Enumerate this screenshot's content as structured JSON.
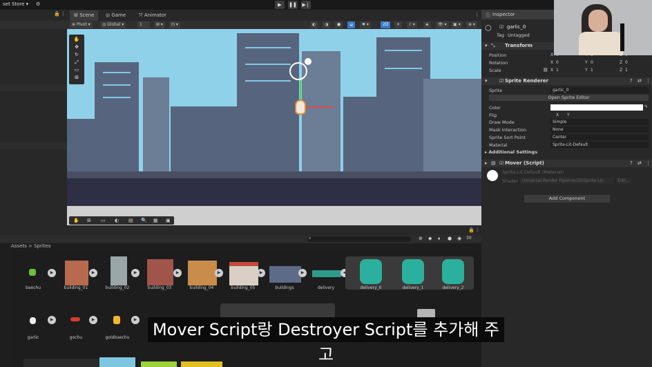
{
  "topbar": {
    "store_label": "set Store ▾",
    "play": "▶",
    "pause": "❚❚",
    "step": "▶❘"
  },
  "tabs": [
    {
      "label": "Scene"
    },
    {
      "label": "Game"
    },
    {
      "label": "Animator"
    }
  ],
  "scene_toolbar": {
    "pivot": "Pivot",
    "global": "Global",
    "grid_value": "1",
    "mode_2d": "2D"
  },
  "project": {
    "breadcrumb": "Assets > Sprites",
    "item_count": "30",
    "search_placeholder": "",
    "assets": [
      {
        "name": "baechu"
      },
      {
        "name": "building_01"
      },
      {
        "name": "building_02"
      },
      {
        "name": "building_03"
      },
      {
        "name": "building_04"
      },
      {
        "name": "building_05"
      },
      {
        "name": "buildings"
      },
      {
        "name": "delivery"
      },
      {
        "name": "delivery_0"
      },
      {
        "name": "delivery_1"
      },
      {
        "name": "delivery_2"
      },
      {
        "name": "garlic"
      },
      {
        "name": "gochu"
      },
      {
        "name": "goldbaechu"
      }
    ]
  },
  "inspector": {
    "tab": "Inspector",
    "object_name": "garlic_0",
    "tag_label": "Tag",
    "tag_value": "Untagged",
    "transform": {
      "title": "Transform",
      "position_label": "Position",
      "rotation_label": "Rotation",
      "scale_label": "Scale",
      "position": {
        "x": "0",
        "y": "0",
        "z": "0"
      },
      "rotation": {
        "x": "0",
        "y": "0",
        "z": "0"
      },
      "scale": {
        "x": "1",
        "y": "1",
        "z": "1"
      }
    },
    "sprite_renderer": {
      "title": "Sprite Renderer",
      "sprite_label": "Sprite",
      "sprite_value": "garlic_0",
      "open_editor": "Open Sprite Editor",
      "color_label": "Color",
      "flip_label": "Flip",
      "flip_x": "X",
      "flip_y": "Y",
      "draw_mode_label": "Draw Mode",
      "draw_mode_value": "Simple",
      "mask_label": "Mask Interaction",
      "mask_value": "None",
      "sort_point_label": "Sprite Sort Point",
      "sort_point_value": "Center",
      "material_label": "Material",
      "material_value": "Sprite-Lit-Default",
      "additional": "Additional Settings"
    },
    "mover": {
      "title": "Mover (Script)"
    },
    "material_block": {
      "name": "Sprite-Lit-Default (Material)",
      "shader_label": "Shader",
      "shader_value": "Universal Render Pipeline/2D/Sprite-Lit-",
      "edit": "Edit..."
    },
    "add_component": "Add Component"
  },
  "subtitle": "Mover Script랑 Destroyer Script를 추가해 주고",
  "colors": {
    "sky": "#8fd1e8",
    "building": "#6c7d96",
    "accent": "#3a79c8"
  }
}
